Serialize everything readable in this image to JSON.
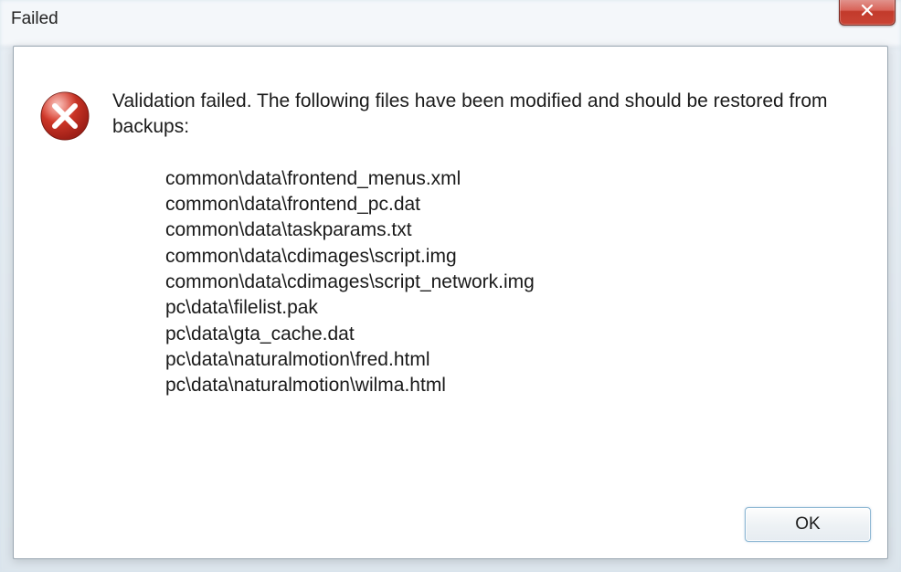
{
  "window": {
    "title": "Failed"
  },
  "dialog": {
    "message": "Validation failed. The following files have been modified and should be restored from backups:",
    "files": [
      "common\\data\\frontend_menus.xml",
      "common\\data\\frontend_pc.dat",
      "common\\data\\taskparams.txt",
      "common\\data\\cdimages\\script.img",
      "common\\data\\cdimages\\script_network.img",
      "pc\\data\\filelist.pak",
      "pc\\data\\gta_cache.dat",
      "pc\\data\\naturalmotion\\fred.html",
      "pc\\data\\naturalmotion\\wilma.html"
    ],
    "ok_label": "OK"
  }
}
